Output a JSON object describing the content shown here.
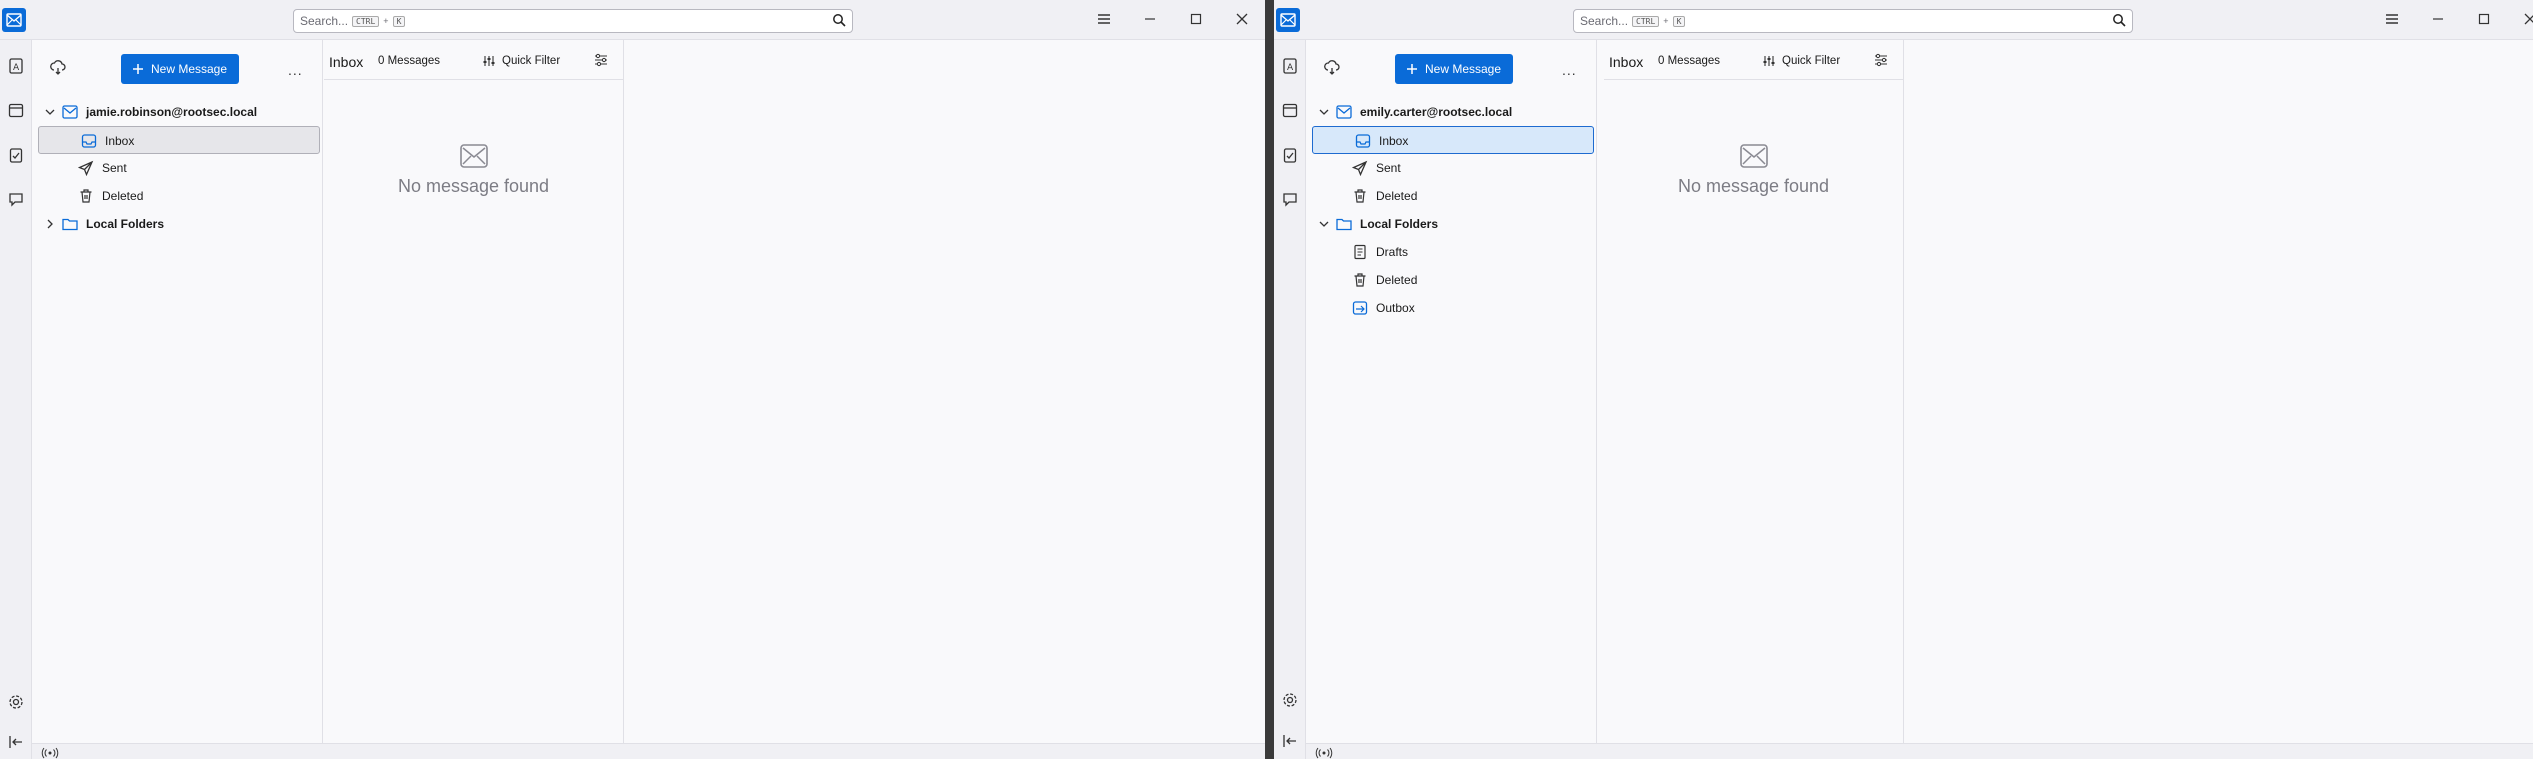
{
  "windows": [
    {
      "search": {
        "placeholder": "Search...",
        "key1": "CTRL",
        "plus": "+",
        "key2": "K"
      },
      "toolbar": {
        "new_message_label": "New Message",
        "more_label": "..."
      },
      "account": {
        "name": "jamie.robinson@rootsec.local"
      },
      "folders": [
        {
          "label": "Inbox",
          "icon": "inbox-icon",
          "selected": true
        },
        {
          "label": "Sent",
          "icon": "sent-icon"
        },
        {
          "label": "Deleted",
          "icon": "trash-icon"
        }
      ],
      "local_folders": {
        "label": "Local Folders",
        "expanded": false,
        "items": []
      },
      "list": {
        "folder": "Inbox",
        "count": "0 Messages",
        "quick_filter": "Quick Filter",
        "empty": "No message found"
      }
    },
    {
      "search": {
        "placeholder": "Search...",
        "key1": "CTRL",
        "plus": "+",
        "key2": "K"
      },
      "toolbar": {
        "new_message_label": "New Message",
        "more_label": "..."
      },
      "account": {
        "name": "emily.carter@rootsec.local"
      },
      "folders": [
        {
          "label": "Inbox",
          "icon": "inbox-icon",
          "selected": true
        },
        {
          "label": "Sent",
          "icon": "sent-icon"
        },
        {
          "label": "Deleted",
          "icon": "trash-icon"
        }
      ],
      "local_folders": {
        "label": "Local Folders",
        "expanded": true,
        "items": [
          {
            "label": "Drafts",
            "icon": "drafts-icon"
          },
          {
            "label": "Deleted",
            "icon": "trash-icon"
          },
          {
            "label": "Outbox",
            "icon": "outbox-icon"
          }
        ]
      },
      "list": {
        "folder": "Inbox",
        "count": "0 Messages",
        "quick_filter": "Quick Filter",
        "empty": "No message found"
      }
    }
  ],
  "colors": {
    "accent": "#0a6bd8",
    "selection_blue": "#d7e8fa",
    "selection_grey": "#e6e6ea"
  }
}
